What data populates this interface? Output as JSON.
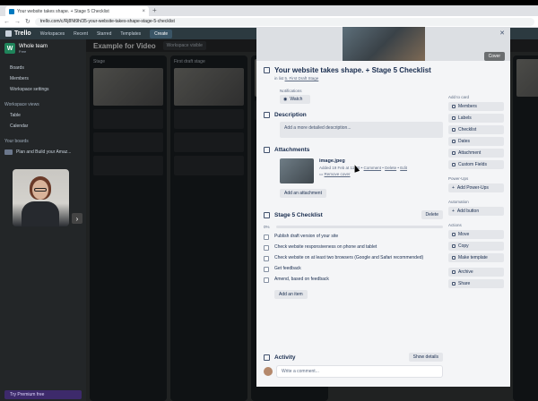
{
  "browser": {
    "tab_title": "Your website takes shape. + Stage 5 Checklist",
    "url": "trello.com/c/Rj8Nt9h/35-your-website-takes-shape-stage-5-checklist"
  },
  "header": {
    "logo": "Trello",
    "menus": [
      "Workspaces",
      "Recent",
      "Starred",
      "Templates"
    ],
    "create": "Create"
  },
  "sidebar": {
    "workspace_initial": "W",
    "workspace_name": "Whole team",
    "workspace_plan": "Free",
    "items": [
      "Boards",
      "Members",
      "Workspace settings"
    ],
    "views_label": "Workspace views",
    "views": [
      "Table",
      "Calendar"
    ],
    "boards_label": "Your boards",
    "boards": [
      "Plan and Build your Amaz..."
    ],
    "premium": "Try Premium free"
  },
  "board": {
    "title": "Example for Video",
    "chips": [
      "Workspace visible"
    ],
    "lists": [
      "Stage",
      "First draft stage"
    ]
  },
  "card": {
    "title": "Your website takes shape. + Stage 5 Checklist",
    "in_list_prefix": "in list",
    "in_list": "5. First Draft Stage",
    "cover_button": "Cover",
    "notifications_label": "Notifications",
    "watch": "Watch",
    "description_heading": "Description",
    "description_placeholder": "Add a more detailed description...",
    "attachments_heading": "Attachments",
    "attachment": {
      "name": "image.jpeg",
      "added": "Added 19 Feb at 11:20",
      "comment": "Comment",
      "delete": "Delete",
      "edit": "Edit",
      "remove_cover": "Remove cover"
    },
    "add_attachment": "Add an attachment",
    "checklist_heading": "Stage 5 Checklist",
    "checklist_delete": "Delete",
    "checklist_progress": "0%",
    "checklist_items": [
      "Publish draft version of your site",
      "Check website responsiveness on phone and tablet",
      "Check website on at least two browsers (Google and Safari recommended)",
      "Get feedback",
      "Amend, based on feedback"
    ],
    "add_item": "Add an item",
    "activity_heading": "Activity",
    "show_details": "Show details",
    "comment_placeholder": "Write a comment..."
  },
  "card_sidebar": {
    "add_to_card_label": "Add to card",
    "add_to_card": [
      "Members",
      "Labels",
      "Checklist",
      "Dates",
      "Attachment",
      "Custom Fields"
    ],
    "powerups_label": "Power-Ups",
    "add_powerups": "Add Power-Ups",
    "automation_label": "Automation",
    "add_button": "Add button",
    "actions_label": "Actions",
    "actions": [
      "Move",
      "Copy",
      "Make template",
      "Archive",
      "Share"
    ]
  }
}
